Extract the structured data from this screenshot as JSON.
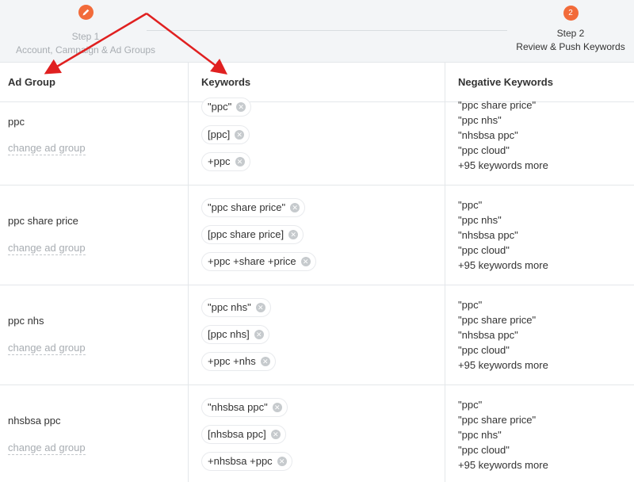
{
  "stepper": {
    "steps": [
      {
        "number": "",
        "icon": "pencil-icon",
        "title": "Step 1",
        "subtitle": "Account, Campaign & Ad Groups"
      },
      {
        "number": "2",
        "icon": "",
        "title": "Step 2",
        "subtitle": "Review & Push Keywords"
      }
    ]
  },
  "table": {
    "headers": [
      "Ad Group",
      "Keywords",
      "Negative Keywords"
    ],
    "change_label": "change ad group",
    "rows": [
      {
        "ad_group": "ppc",
        "keywords": [
          "\"ppc\"",
          "[ppc]",
          "+ppc"
        ],
        "negative": [
          "\"ppc share price\"",
          "\"ppc nhs\"",
          "\"nhsbsa ppc\"",
          "\"ppc cloud\"",
          "+95 keywords more"
        ]
      },
      {
        "ad_group": "ppc share price",
        "keywords": [
          "\"ppc share price\"",
          "[ppc share price]",
          "+ppc +share +price"
        ],
        "negative": [
          "\"ppc\"",
          "\"ppc nhs\"",
          "\"nhsbsa ppc\"",
          "\"ppc cloud\"",
          "+95 keywords more"
        ]
      },
      {
        "ad_group": "ppc nhs",
        "keywords": [
          "\"ppc nhs\"",
          "[ppc nhs]",
          "+ppc +nhs"
        ],
        "negative": [
          "\"ppc\"",
          "\"ppc share price\"",
          "\"nhsbsa ppc\"",
          "\"ppc cloud\"",
          "+95 keywords more"
        ]
      },
      {
        "ad_group": "nhsbsa ppc",
        "keywords": [
          "\"nhsbsa ppc\"",
          "[nhsbsa ppc]",
          "+nhsbsa +ppc"
        ],
        "negative": [
          "\"ppc\"",
          "\"ppc share price\"",
          "\"ppc nhs\"",
          "\"ppc cloud\"",
          "+95 keywords more"
        ]
      }
    ]
  },
  "colors": {
    "accent": "#f26b3a",
    "annotation_arrow": "#e02020",
    "chip_remove": "#c6cacd"
  }
}
